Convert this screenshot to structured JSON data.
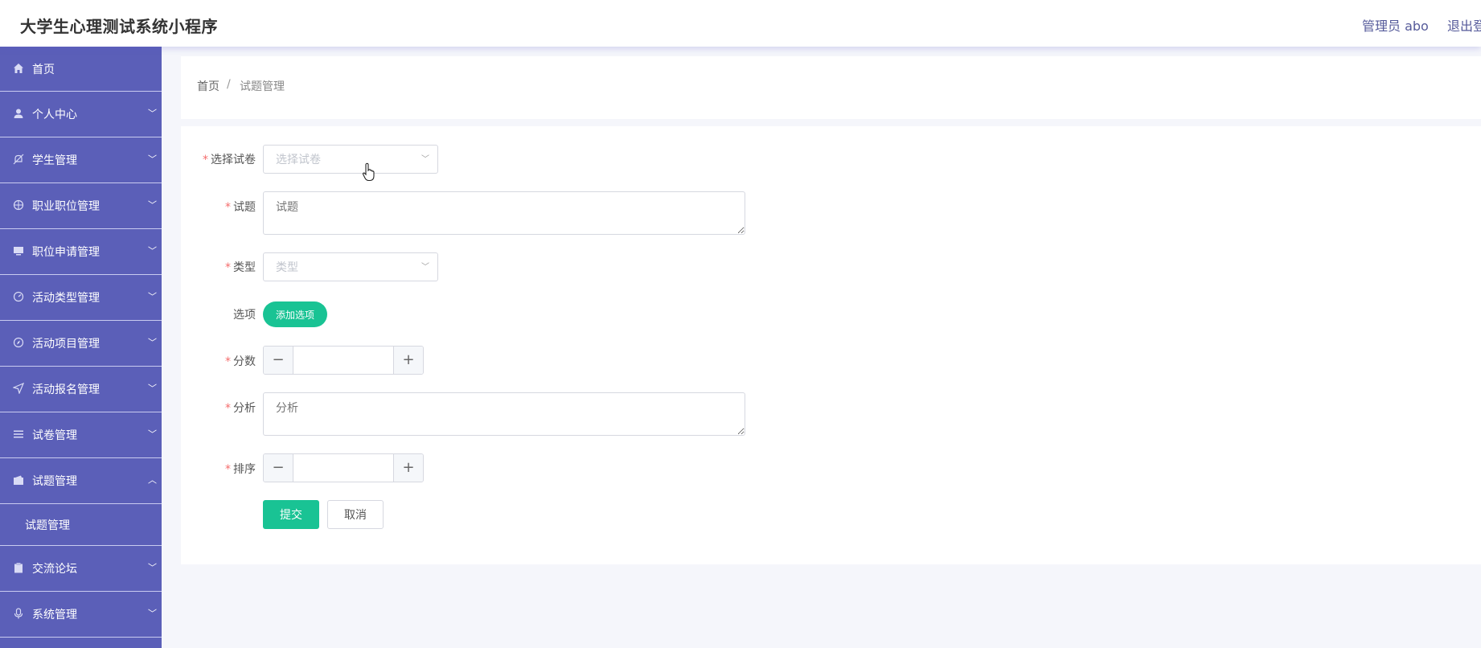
{
  "header": {
    "title": "大学生心理测试系统小程序",
    "admin_label": "管理员 abo",
    "logout_label": "退出登录"
  },
  "sidebar": {
    "items": [
      {
        "label": "首页",
        "icon": "home-icon"
      },
      {
        "label": "个人中心",
        "icon": "user-icon"
      },
      {
        "label": "学生管理",
        "icon": "bell-off-icon"
      },
      {
        "label": "职业职位管理",
        "icon": "basketball-icon"
      },
      {
        "label": "职位申请管理",
        "icon": "monitor-icon"
      },
      {
        "label": "活动类型管理",
        "icon": "gauge-icon"
      },
      {
        "label": "活动项目管理",
        "icon": "compass-icon"
      },
      {
        "label": "活动报名管理",
        "icon": "send-icon"
      },
      {
        "label": "试卷管理",
        "icon": "list-icon"
      },
      {
        "label": "试题管理",
        "icon": "wallet-icon"
      },
      {
        "label": "交流论坛",
        "icon": "clipboard-icon"
      },
      {
        "label": "系统管理",
        "icon": "microphone-icon"
      }
    ],
    "submenu_label": "试题管理"
  },
  "breadcrumb": {
    "home": "首页",
    "separator": "/",
    "current": "试题管理"
  },
  "form": {
    "paper_label": "选择试卷",
    "paper_placeholder": "选择试卷",
    "question_label": "试题",
    "question_placeholder": "试题",
    "type_label": "类型",
    "type_placeholder": "类型",
    "options_label": "选项",
    "add_option_label": "添加选项",
    "score_label": "分数",
    "analysis_label": "分析",
    "analysis_placeholder": "分析",
    "sort_label": "排序",
    "submit_label": "提交",
    "cancel_label": "取消",
    "required_mark": "*"
  },
  "colors": {
    "sidebar_bg": "#5b5fb8",
    "accent_green": "#19c394",
    "required_red": "#f56c6c"
  }
}
